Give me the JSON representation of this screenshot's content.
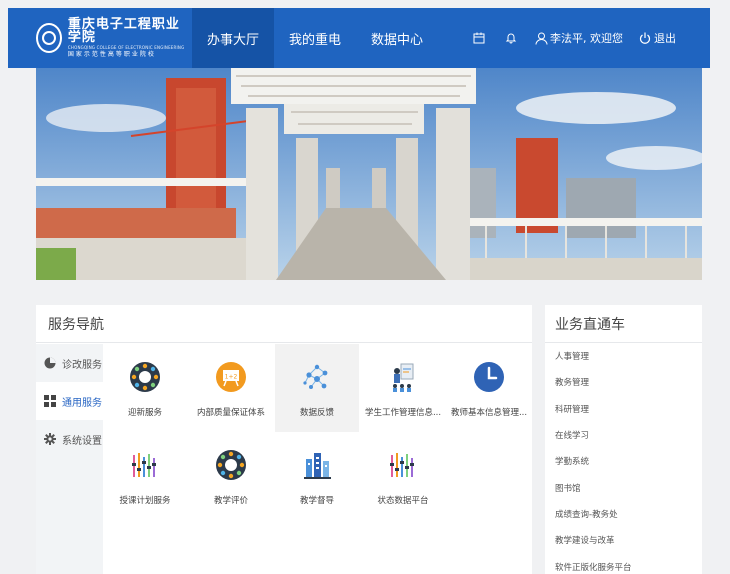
{
  "header": {
    "logo_cn": "重庆电子工程职业学院",
    "logo_en": "CHONGQING COLLEGE OF ELECTRONIC ENGINEERING",
    "logo_sub": "国家示范性高等职业院校",
    "nav": [
      {
        "label": "办事大厅",
        "active": true
      },
      {
        "label": "我的重电",
        "active": false
      },
      {
        "label": "数据中心",
        "active": false
      }
    ],
    "user_text": "李法平, 欢迎您",
    "logout_label": "退出",
    "icons": [
      "calendar-icon",
      "bell-icon",
      "user-icon",
      "power-icon"
    ]
  },
  "service_nav": {
    "title": "服务导航",
    "tabs": [
      {
        "label": "诊改服务",
        "icon": "pie-chart-icon",
        "active": false
      },
      {
        "label": "通用服务",
        "icon": "grid-icon",
        "active": true
      },
      {
        "label": "系统设置",
        "icon": "gear-icon",
        "active": false
      }
    ],
    "tiles": [
      {
        "label": "迎新服务",
        "icon": "ring-icon"
      },
      {
        "label": "内部质量保证体系",
        "icon": "orange-board-icon"
      },
      {
        "label": "数据反馈",
        "icon": "network-icon"
      },
      {
        "label": "学生工作管理信息...",
        "icon": "presenter-icon"
      },
      {
        "label": "教师基本信息管理...",
        "icon": "clock-icon"
      },
      {
        "label": "授课计划服务",
        "icon": "bars-icon"
      },
      {
        "label": "教学评价",
        "icon": "ring-icon"
      },
      {
        "label": "教学督导",
        "icon": "building-icon"
      },
      {
        "label": "状态数据平台",
        "icon": "bars-icon"
      }
    ]
  },
  "quick_links": {
    "title": "业务直通车",
    "items": [
      "人事管理",
      "教务管理",
      "科研管理",
      "在线学习",
      "学勤系统",
      "图书馆",
      "成绩查询-教务处",
      "教学建设与改革",
      "软件正版化服务平台"
    ]
  },
  "colors": {
    "header_bg": "#1f64c0",
    "nav_active_bg": "#1553a6",
    "accent": "#2a67c4"
  }
}
